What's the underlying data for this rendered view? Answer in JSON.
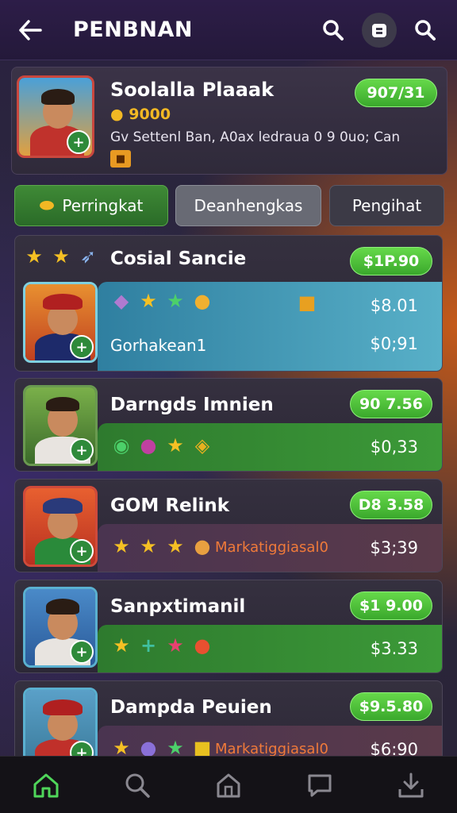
{
  "header": {
    "title": "PENBNAN"
  },
  "profile": {
    "name": "Soolalla Plaaak",
    "coins": "9000",
    "description": "Gv Settenl Ban, A0ax ledraua 0 9 0uo; Can",
    "badge": "907/31"
  },
  "tabs": [
    {
      "label": "Perringkat"
    },
    {
      "label": "Deanhengkas"
    },
    {
      "label": "Pengihat"
    }
  ],
  "items": [
    {
      "name": "Cosial Sancie",
      "badge": "$1P.90",
      "sub": "Gorhakean1",
      "amount_top": "$8.01",
      "amount": "$0;91"
    },
    {
      "name": "Darngds Imnien",
      "badge": "90 7.56",
      "amount": "$0,33"
    },
    {
      "name": "GOM Relink",
      "badge": "D8 3.58",
      "sub": "Markatiggiasal0",
      "amount": "$3;39"
    },
    {
      "name": "Sanpxtimanil",
      "badge": "$1 9.00",
      "amount": "$3.33"
    },
    {
      "name": "Dampda Peuien",
      "badge": "$9.5.80",
      "sub": "Markatiggiasal0",
      "amount": "$6:90"
    }
  ],
  "icons": {
    "back": "arrow-left-icon",
    "search": "search-icon",
    "menu": "bag-icon",
    "nav": [
      "home-icon",
      "search-icon",
      "house-icon",
      "chat-icon",
      "download-icon"
    ]
  },
  "colors": {
    "accent_green": "#3aa82c",
    "coin_gold": "#f2b824",
    "nav_active": "#4fd65a"
  }
}
